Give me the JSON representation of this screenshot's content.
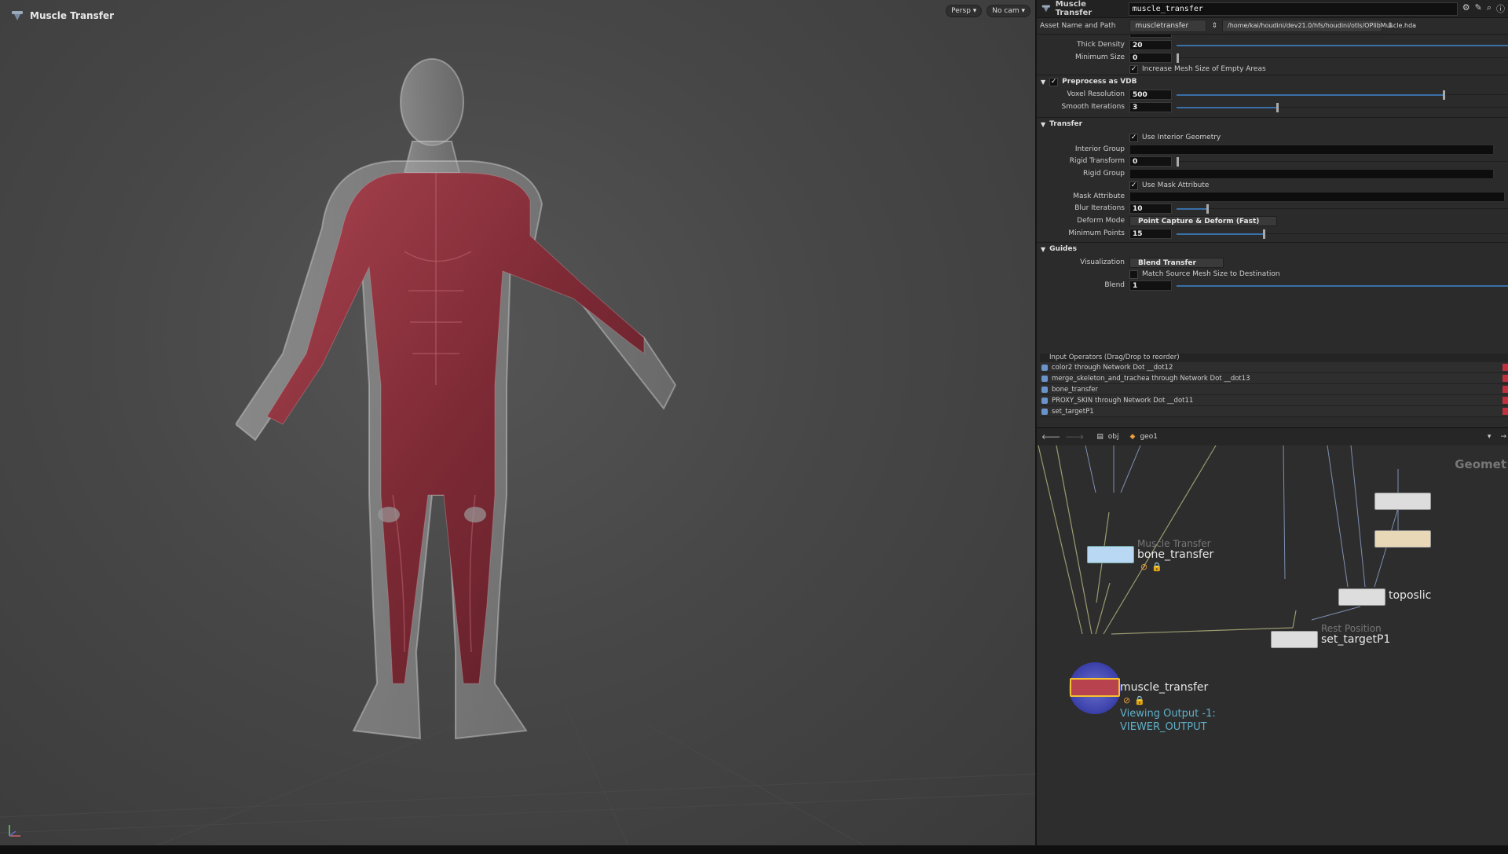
{
  "viewport": {
    "title": "Muscle Transfer",
    "persp_label": "Persp ▾",
    "cam_label": "No cam ▾"
  },
  "params": {
    "header_type": "Muscle Transfer",
    "node_name": "muscle_transfer",
    "asset_label": "Asset Name and Path",
    "asset_name": "muscletransfer",
    "asset_path": "/home/kai/houdini/dev21.0/hfs/houdini/otls/OPlibMuscle.hda",
    "rows": {
      "thick_density_label": "Thick Density",
      "thick_density_value": "20",
      "min_size_label": "Minimum Size",
      "min_size_value": "0",
      "increase_mesh_label": "Increase Mesh Size of Empty Areas",
      "preprocess_label": "Preprocess as VDB",
      "voxel_res_label": "Voxel Resolution",
      "voxel_res_value": "500",
      "smooth_iter_label": "Smooth Iterations",
      "smooth_iter_value": "3",
      "transfer_label": "Transfer",
      "use_interior_label": "Use Interior Geometry",
      "interior_group_label": "Interior Group",
      "rigid_transform_label": "Rigid Transform",
      "rigid_transform_value": "0",
      "rigid_group_label": "Rigid Group",
      "use_mask_label": "Use Mask Attribute",
      "mask_attr_label": "Mask Attribute",
      "blur_iter_label": "Blur Iterations",
      "blur_iter_value": "10",
      "deform_mode_label": "Deform Mode",
      "deform_mode_value": "Point Capture & Deform (Fast)",
      "min_points_label": "Minimum Points",
      "min_points_value": "15",
      "guides_label": "Guides",
      "visualization_label": "Visualization",
      "visualization_value": "Blend Transfer",
      "match_source_label": "Match Source Mesh Size to Destination",
      "blend_label": "Blend",
      "blend_value": "1"
    },
    "sliders": {
      "thick_density": 1.0,
      "voxel_res": 0.82,
      "smooth_iter": 0.3,
      "rigid_transform": 0.0,
      "blur_iter": 0.1,
      "min_points": 0.25,
      "blend": 1.0
    },
    "input_operators_label": "Input Operators (Drag/Drop to reorder)",
    "input_operators": [
      "color2 through Network Dot __dot12",
      "merge_skeleton_and_trachea through Network Dot __dot13",
      "bone_transfer",
      "PROXY_SKIN through Network Dot __dot11",
      "set_targetP1"
    ]
  },
  "network": {
    "path_obj": "obj",
    "path_geo": "geo1",
    "context_label": "Geomet",
    "nodes": {
      "bone_transfer_type": "Muscle Transfer",
      "bone_transfer_name": "bone_transfer",
      "toposlide_name": "toposlic",
      "set_target_type": "Rest Position",
      "set_target_name": "set_targetP1",
      "muscle_transfer_name": "muscle_transfer",
      "viewing_line1": "Viewing Output -1:",
      "viewing_line2": "VIEWER_OUTPUT"
    }
  },
  "colors": {
    "accent_blue": "#3a6fa8",
    "muscle_red": "#8a2f3a",
    "viewing_cyan": "#5fb0c8"
  }
}
